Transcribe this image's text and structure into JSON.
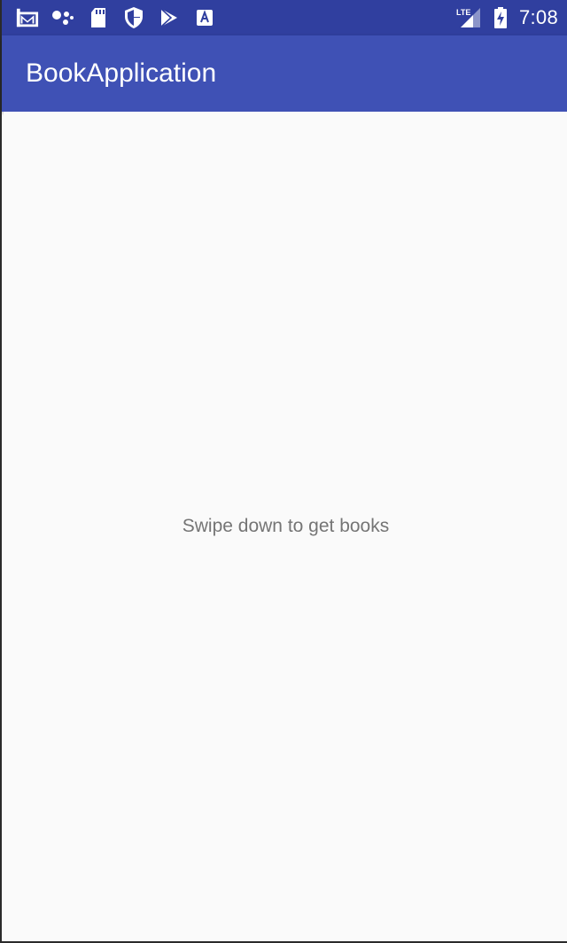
{
  "status_bar": {
    "left_icons": [
      "gmail-icon",
      "assistant-dots-icon",
      "sd-card-icon",
      "shield-icon",
      "play-store-icon",
      "text-a-icon"
    ],
    "right_icons": [
      "lte-signal-icon",
      "battery-charging-icon"
    ],
    "network_label": "LTE",
    "time": "7:08"
  },
  "app_bar": {
    "title": "BookApplication"
  },
  "main": {
    "empty_message": "Swipe down to get books"
  },
  "colors": {
    "status_bar": "#303f9f",
    "app_bar": "#3f51b5",
    "background": "#fafafa",
    "message_text": "#757575"
  }
}
